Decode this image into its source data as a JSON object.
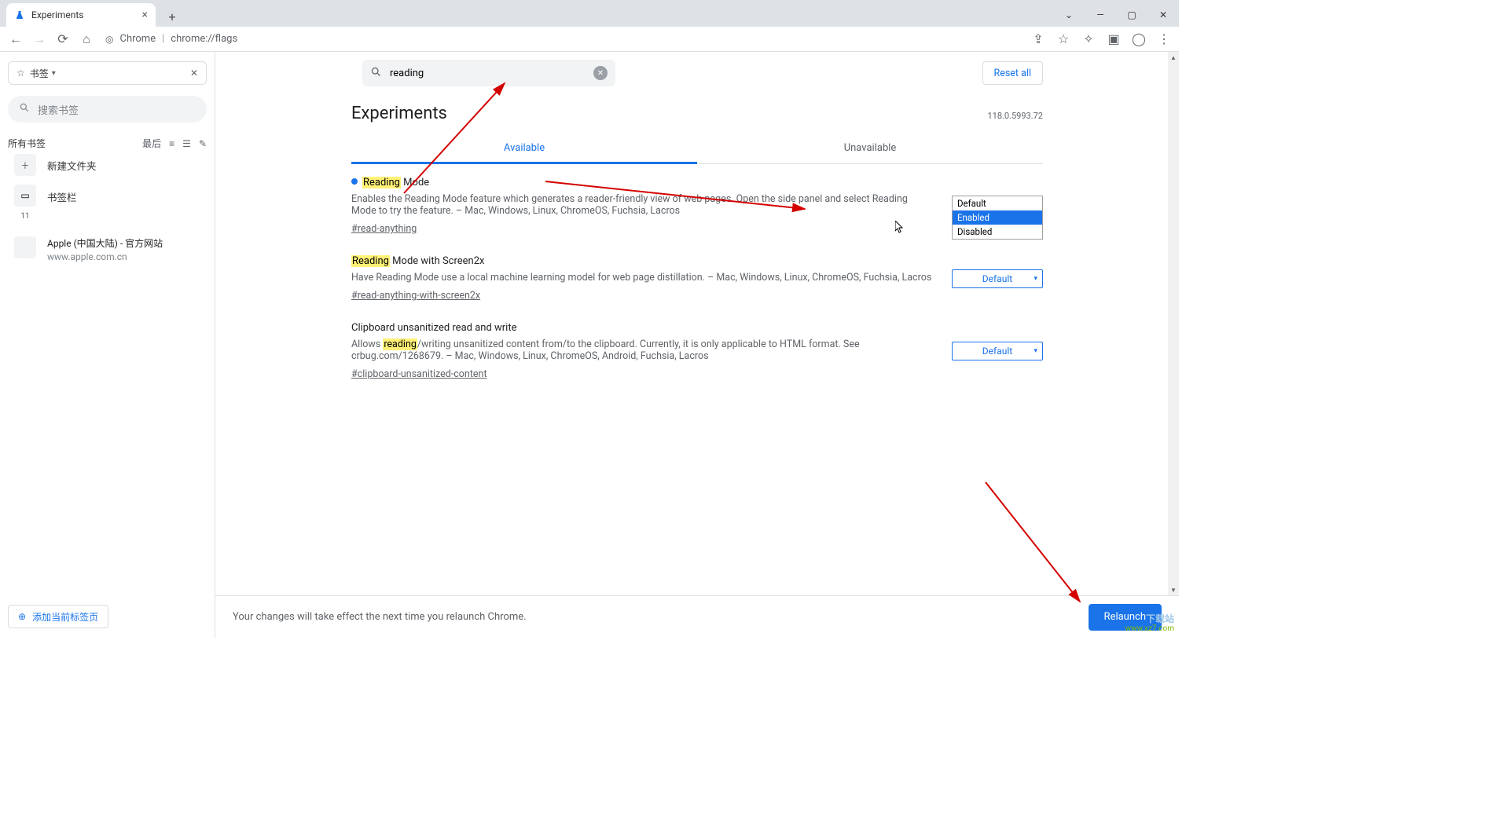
{
  "browser": {
    "tab_title": "Experiments",
    "url_label": "Chrome",
    "url": "chrome://flags"
  },
  "sidebar": {
    "bookmarks_label": "书签",
    "search_placeholder": "搜索书签",
    "all_bookmarks": "所有书签",
    "sort_label": "最后",
    "new_folder": "新建文件夹",
    "bookmark_bar": "书签栏",
    "bookmark_bar_count": "11",
    "apple_title": "Apple (中国大陆) - 官方网站",
    "apple_url": "www.apple.com.cn",
    "add_current": "添加当前标签页"
  },
  "flags": {
    "search_value": "reading",
    "reset_label": "Reset all",
    "page_title": "Experiments",
    "version": "118.0.5993.72",
    "tab_available": "Available",
    "tab_unavailable": "Unavailable",
    "items": [
      {
        "highlight": "Reading",
        "name_rest": " Mode",
        "desc_pre": "Enables the Reading Mode feature which generates a reader-friendly view of web pages. Open the side panel and select Reading Mode to try the feature. – Mac, Windows, Linux, ChromeOS, Fuchsia, Lacros",
        "hash": "#read-anything",
        "select": "Enabled",
        "modified": true,
        "open": true
      },
      {
        "highlight": "Reading",
        "name_rest": " Mode with Screen2x",
        "desc_pre": "Have Reading Mode use a local machine learning model for web page distillation. – Mac, Windows, Linux, ChromeOS, Fuchsia, Lacros",
        "hash": "#read-anything-with-screen2x",
        "select": "Default",
        "modified": false,
        "open": false
      },
      {
        "name_pre": "Clipboard unsanitized read and write",
        "desc_before": "Allows ",
        "desc_hl": "reading",
        "desc_after": "/writing unsanitized content from/to the clipboard. Currently, it is only applicable to HTML format. See crbug.com/1268679. – Mac, Windows, Linux, ChromeOS, Android, Fuchsia, Lacros",
        "hash": "#clipboard-unsanitized-content",
        "select": "Default",
        "modified": false,
        "open": false
      }
    ],
    "dropdown_options": [
      "Default",
      "Enabled",
      "Disabled"
    ],
    "restart_msg": "Your changes will take effect the next time you relaunch Chrome.",
    "relaunch": "Relaunch"
  },
  "watermark": {
    "l1": "下载站",
    "l2": "www.xz7.com"
  }
}
